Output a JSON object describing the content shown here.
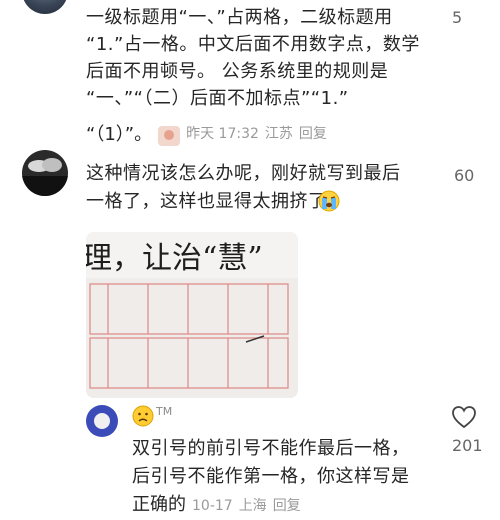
{
  "comments": [
    {
      "text_lines": "一级标题用“一、”占两格，二级标题用\n“1.”占一格。中文后面不用数字点，数学\n后面不用顿号。 公务系统里的规则是\n“一、”“（二）后面不加标点”“1.”",
      "text_tail": "“（1）”。",
      "time": "昨天 17:32",
      "location": "江苏",
      "reply_label": "回复",
      "likes": "5"
    },
    {
      "text_lines": "这种情况该怎么办呢，刚好就写到最后\n一格了，这样也显得太拥挤了",
      "likes": "60"
    }
  ],
  "photo": {
    "handwriting": "理，让治“慧”"
  },
  "reply": {
    "badge": "TM",
    "text_lines": "双引号的前引号不能作最后一格，\n后引号不能作第一格，你这样写是",
    "text_tail": "正确的",
    "date": "10-17",
    "location": "上海",
    "reply_label": "回复",
    "likes": "201"
  }
}
